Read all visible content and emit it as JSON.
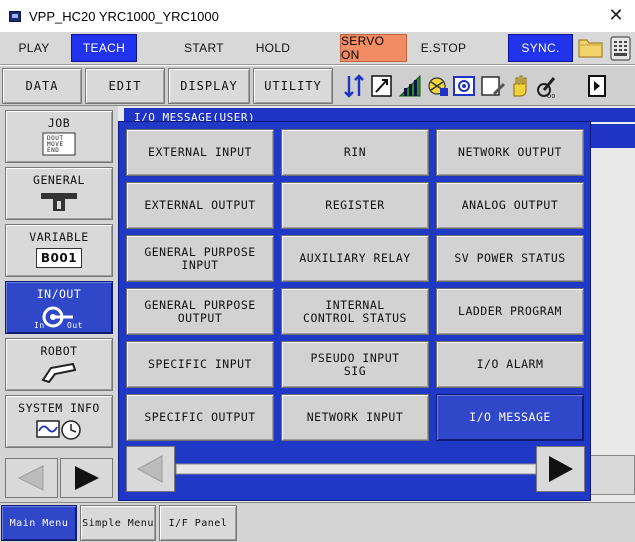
{
  "window": {
    "title": "VPP_HC20 YRC1000_YRC1000",
    "close_glyph": "✕"
  },
  "toprow": {
    "play": "PLAY",
    "teach": "TEACH",
    "start": "START",
    "hold": "HOLD",
    "servo_on": "SERVO ON",
    "estop": "E.STOP",
    "sync": "SYNC.",
    "icons": [
      "folder-icon",
      "keyboard-icon"
    ]
  },
  "menu": {
    "data": "DATA",
    "edit": "EDIT",
    "display": "DISPLAY",
    "utility": "UTILITY",
    "status_icons": [
      "coordinate-icon",
      "tool-icon",
      "speed-icon",
      "security-icon",
      "camera-icon",
      "edit-lock-icon",
      "hand-icon",
      "cycle-icon",
      "page-icon"
    ]
  },
  "left_menu": {
    "items": [
      {
        "label": "JOB",
        "sub": [
          "DOUT",
          "MOVE",
          "END"
        ]
      },
      {
        "label": "GENERAL"
      },
      {
        "label": "VARIABLE",
        "badge": "B001"
      },
      {
        "label": "IN/OUT",
        "sub_in": "In",
        "sub_out": "Out"
      },
      {
        "label": "ROBOT"
      },
      {
        "label": "SYSTEM INFO"
      }
    ]
  },
  "content": {
    "header": "I/O MESSAGE(USER)"
  },
  "submenu": {
    "items": [
      "EXTERNAL INPUT",
      "RIN",
      "NETWORK OUTPUT",
      "EXTERNAL OUTPUT",
      "REGISTER",
      "ANALOG OUTPUT",
      "GENERAL PURPOSE\nINPUT",
      "AUXILIARY RELAY",
      "SV POWER STATUS",
      "GENERAL PURPOSE\nOUTPUT",
      "INTERNAL\n CONTROL STATUS",
      "LADDER PROGRAM",
      "SPECIFIC INPUT",
      "PSEUDO INPUT\nSIG",
      "I/O ALARM",
      "SPECIFIC OUTPUT",
      "NETWORK INPUT",
      "I/O MESSAGE"
    ],
    "selected": "I/O MESSAGE"
  },
  "bottom_tabs": {
    "main_menu": "Main Menu",
    "simple_menu": "Simple Menu",
    "if_panel": "I/F Panel"
  },
  "colors": {
    "accent_blue": "#2233ee",
    "panel_blue": "#1f38c6",
    "servo_orange": "#f28c63"
  }
}
